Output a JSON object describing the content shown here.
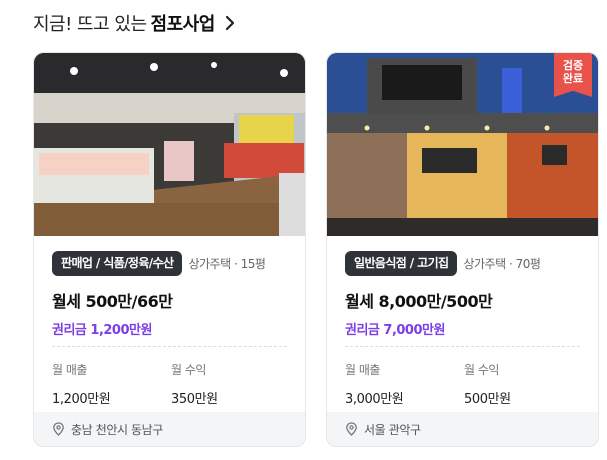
{
  "header": {
    "title_prefix": "지금! 뜨고 있는",
    "title_strong": "점포사업"
  },
  "cards": [
    {
      "category": "판매업 / 식품/정육/수산",
      "meta": "상가주택 · 15평",
      "price": "월세 500만/66만",
      "premium": "권리금 1,200만원",
      "sales_label": "월 매출",
      "sales_value": "1,200만원",
      "profit_label": "월 수익",
      "profit_value": "350만원",
      "location": "충남 천안시 동남구",
      "verified": false
    },
    {
      "category": "일반음식점 / 고기집",
      "meta": "상가주택 · 70평",
      "price": "월세 8,000만/500만",
      "premium": "권리금 7,000만원",
      "sales_label": "월 매출",
      "sales_value": "3,000만원",
      "profit_label": "월 수익",
      "profit_value": "500만원",
      "location": "서울 관악구",
      "verified": true,
      "verified_line1": "검증",
      "verified_line2": "완료"
    }
  ],
  "colors": {
    "tag_bg": "#2f3238",
    "premium_text": "#7b3fe4",
    "verified_badge": "#e8524a",
    "location_bar": "#f4f5f7"
  },
  "icons": {
    "header_arrow": "chevron-right-icon",
    "location": "map-pin-icon"
  }
}
